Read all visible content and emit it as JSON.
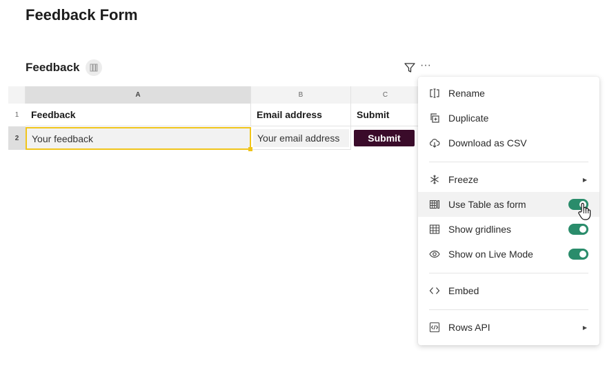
{
  "page": {
    "title": "Feedback Form"
  },
  "table": {
    "name": "Feedback",
    "columns": [
      "A",
      "B",
      "C"
    ],
    "rows": [
      "1",
      "2"
    ],
    "header_cells": [
      "Feedback",
      "Email address",
      "Submit"
    ],
    "feedback_placeholder": "Your feedback",
    "email_placeholder": "Your email address",
    "submit_label": "Submit"
  },
  "menu": {
    "rename": "Rename",
    "duplicate": "Duplicate",
    "download_csv": "Download as CSV",
    "freeze": "Freeze",
    "use_table_as_form": "Use Table as form",
    "show_gridlines": "Show gridlines",
    "show_on_live_mode": "Show on Live Mode",
    "embed": "Embed",
    "rows_api": "Rows API"
  },
  "toggles": {
    "use_table_as_form": true,
    "show_gridlines": true,
    "show_on_live_mode": true
  },
  "colors": {
    "toggle_on": "#2a8c6b",
    "submit_bg": "#3a0b2a",
    "selection": "#f0c419"
  }
}
